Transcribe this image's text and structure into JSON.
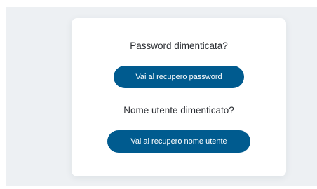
{
  "recovery": {
    "password_title": "Password dimenticata?",
    "password_button_label": "Vai al recupero password",
    "username_title": "Nome utente dimenticato?",
    "username_button_label": "Vai al recupero nome utente"
  },
  "colors": {
    "background": "#edf0f3",
    "card": "#ffffff",
    "button": "#005b8f",
    "button_text": "#ffffff",
    "text": "#2b2e33"
  }
}
